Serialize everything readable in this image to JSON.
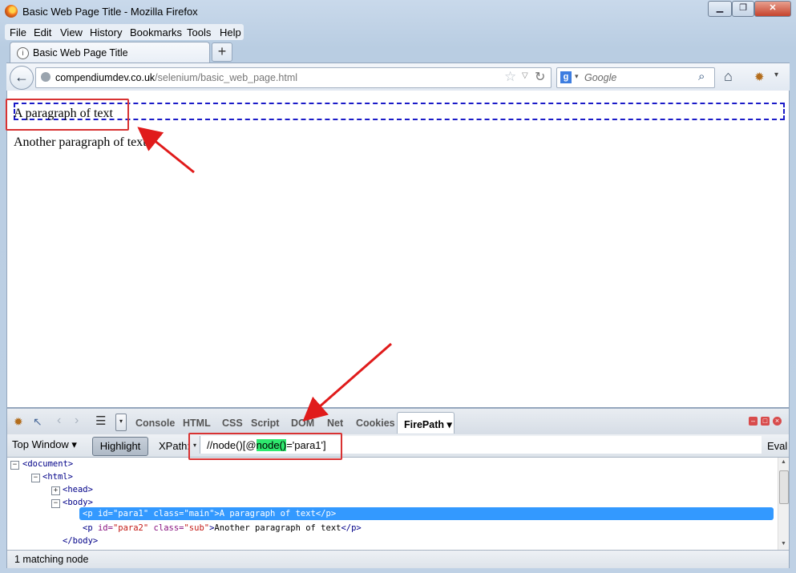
{
  "window": {
    "title": "Basic Web Page Title - Mozilla Firefox",
    "controls": [
      "▁",
      "❐",
      "✕"
    ]
  },
  "menubar": {
    "items": [
      {
        "label": "File"
      },
      {
        "label": "Edit"
      },
      {
        "label": "View"
      },
      {
        "label": "History"
      },
      {
        "label": "Bookmarks"
      },
      {
        "label": "Tools"
      },
      {
        "label": "Help"
      }
    ]
  },
  "tab": {
    "title": "Basic Web Page Title",
    "new_tab_symbol": "+"
  },
  "navbar": {
    "url_domain": "compendiumdev.co.uk",
    "url_path": "/selenium/basic_web_page.html",
    "search_placeholder": "Google",
    "search_engine_letter": "g"
  },
  "page": {
    "para1": "A paragraph of text",
    "para2": "Another paragraph of text"
  },
  "firebug": {
    "tabs": [
      "Console",
      "HTML",
      "CSS",
      "Script",
      "DOM",
      "Net",
      "Cookies"
    ],
    "active_tab": "FirePath ▾",
    "top_window": "Top Window ▾",
    "highlight": "Highlight",
    "xpath_label": "XPath:",
    "xpath_value_before": "//node()[@",
    "xpath_value_highlight": "node()",
    "xpath_value_after": "='para1']",
    "eval": "Eval",
    "tree": {
      "document_open": "<document>",
      "html_open": "<html>",
      "head": "<head>",
      "body_open": "<body>",
      "p1_tag_open": "<p",
      "p1_attr1": "id=",
      "p1_val1": "\"para1\"",
      "p1_attr2": "class=",
      "p1_val2": "\"main\"",
      "p1_text": "A paragraph of text",
      "p1_close": "</p>",
      "p2_tag_open": "<p",
      "p2_attr1": "id=",
      "p2_val1": "\"para2\"",
      "p2_attr2": "class=",
      "p2_val2": "\"sub\"",
      "p2_text": "Another paragraph of text",
      "p2_close": "</p>",
      "body_close": "</body>"
    },
    "status": "1 matching node"
  },
  "colors": {
    "selection": "#3399ff",
    "annotation_red": "#d83232",
    "xpath_highlight": "#2ee86e",
    "outline_blue": "#1a1ac8"
  }
}
